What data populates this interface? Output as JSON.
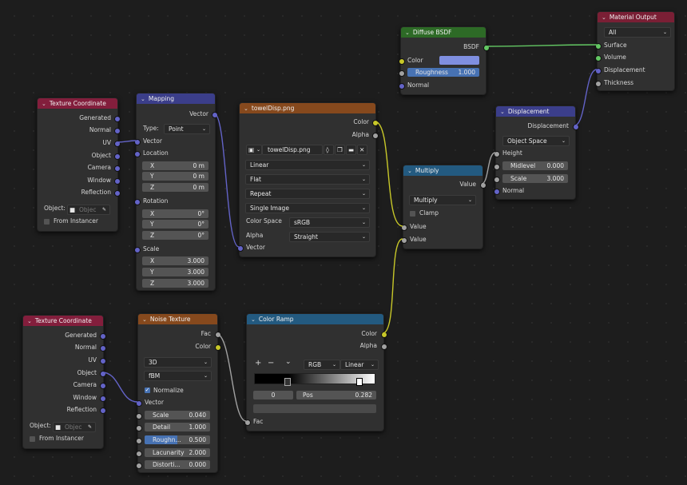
{
  "texcoord1": {
    "title": "Texture Coordinate",
    "outputs": [
      "Generated",
      "Normal",
      "UV",
      "Object",
      "Camera",
      "Window",
      "Reflection"
    ],
    "object_label": "Object:",
    "object_placeholder": "Objec",
    "from_instancer": "From Instancer"
  },
  "mapping": {
    "title": "Mapping",
    "out": "Vector",
    "type_label": "Type:",
    "type_value": "Point",
    "in_vector": "Vector",
    "location": "Location",
    "rotation": "Rotation",
    "scale": "Scale",
    "loc": [
      {
        "axis": "X",
        "value": "0 m"
      },
      {
        "axis": "Y",
        "value": "0 m"
      },
      {
        "axis": "Z",
        "value": "0 m"
      }
    ],
    "rot": [
      {
        "axis": "X",
        "value": "0°"
      },
      {
        "axis": "Y",
        "value": "0°"
      },
      {
        "axis": "Z",
        "value": "0°"
      }
    ],
    "scl": [
      {
        "axis": "X",
        "value": "3.000"
      },
      {
        "axis": "Y",
        "value": "3.000"
      },
      {
        "axis": "Z",
        "value": "3.000"
      }
    ]
  },
  "image": {
    "title": "towelDisp.png",
    "out_color": "Color",
    "out_alpha": "Alpha",
    "filename": "towelDisp.png",
    "interpolation": "Linear",
    "projection": "Flat",
    "extension": "Repeat",
    "source": "Single Image",
    "colorspace_label": "Color Space",
    "colorspace_value": "sRGB",
    "alpha_label": "Alpha",
    "alpha_value": "Straight",
    "in_vector": "Vector"
  },
  "diffuse": {
    "title": "Diffuse BSDF",
    "out": "BSDF",
    "color": "Color",
    "roughness_label": "Roughness",
    "roughness_value": "1.000",
    "normal": "Normal",
    "swatch": "#7f8fe0"
  },
  "output": {
    "title": "Material Output",
    "target": "All",
    "surface": "Surface",
    "volume": "Volume",
    "displacement": "Displacement",
    "thickness": "Thickness"
  },
  "displacement": {
    "title": "Displacement",
    "out": "Displacement",
    "space": "Object Space",
    "height": "Height",
    "midlevel_label": "Midlevel",
    "midlevel_value": "0.000",
    "scale_label": "Scale",
    "scale_value": "3.000",
    "normal": "Normal"
  },
  "multiply": {
    "title": "Multiply",
    "out": "Value",
    "op": "Multiply",
    "clamp": "Clamp",
    "in1": "Value",
    "in2": "Value"
  },
  "texcoord2": {
    "title": "Texture Coordinate",
    "outputs": [
      "Generated",
      "Normal",
      "UV",
      "Object",
      "Camera",
      "Window",
      "Reflection"
    ],
    "object_label": "Object:",
    "object_placeholder": "Objec",
    "from_instancer": "From Instancer"
  },
  "noise": {
    "title": "Noise Texture",
    "out_fac": "Fac",
    "out_color": "Color",
    "dimensions": "3D",
    "type": "fBM",
    "normalize": "Normalize",
    "vector": "Vector",
    "fields": [
      {
        "label": "Scale",
        "value": "0.040"
      },
      {
        "label": "Detail",
        "value": "1.000"
      },
      {
        "label": "Roughn...",
        "value": "0.500",
        "fill": 0.5
      },
      {
        "label": "Lacunarity",
        "value": "2.000"
      },
      {
        "label": "Distorti...",
        "value": "0.000"
      }
    ]
  },
  "ramp": {
    "title": "Color Ramp",
    "out_color": "Color",
    "out_alpha": "Alpha",
    "add": "+",
    "remove": "−",
    "menu": "⌄",
    "mode": "RGB",
    "interp": "Linear",
    "index": "0",
    "pos_label": "Pos",
    "pos_value": "0.282",
    "stop_position": 0.282,
    "in_fac": "Fac"
  },
  "colors": {
    "input": "#831e3c",
    "converter": "#3b3e8a",
    "texture": "#86491d",
    "shader": "#2d6a26",
    "vector": "#3b3e8a",
    "output": "#7a1f35",
    "ramp": "#235a80",
    "vector_socket": "#6363c7",
    "color_socket": "#c7c729",
    "gray_socket": "#a1a1a1",
    "shader_socket": "#63c763"
  }
}
